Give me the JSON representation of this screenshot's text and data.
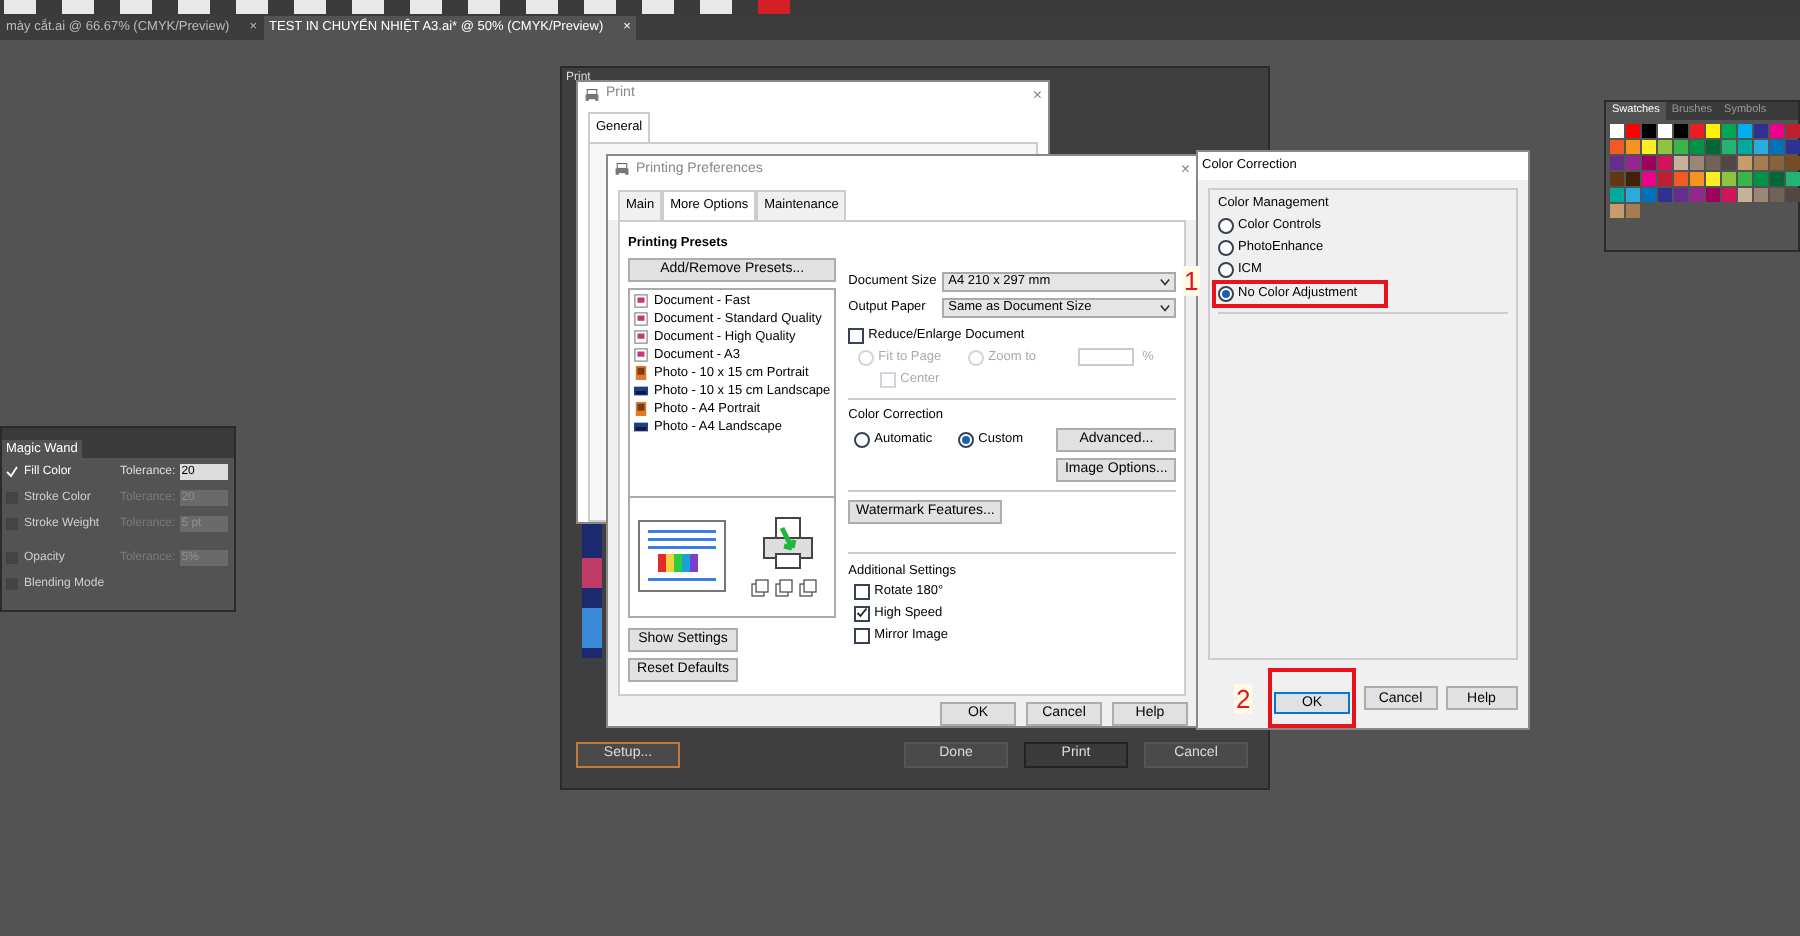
{
  "document_tabs": [
    {
      "label": "mày cắt.ai @ 66.67% (CMYK/Preview)",
      "close": "×",
      "selected": false
    },
    {
      "label": "TEST IN CHUYỂN NHIỆT A3.ai* @ 50% (CMYK/Preview)",
      "close": "×",
      "selected": true
    }
  ],
  "magic_wand": {
    "title": "Magic Wand",
    "options": [
      {
        "label": "Fill Color",
        "checked": true,
        "tolerance_label": "Tolerance:",
        "value": "20",
        "disabled": false
      },
      {
        "label": "Stroke Color",
        "checked": false,
        "tolerance_label": "Tolerance:",
        "value": "20",
        "disabled": true
      },
      {
        "label": "Stroke Weight",
        "checked": false,
        "tolerance_label": "Tolerance:",
        "value": "5 pt",
        "disabled": true
      },
      {
        "label": "Opacity",
        "checked": false,
        "tolerance_label": "Tolerance:",
        "value": "5%",
        "disabled": true
      },
      {
        "label": "Blending Mode",
        "checked": false
      }
    ]
  },
  "swatches": {
    "tabs": [
      {
        "label": "Swatches",
        "selected": true
      },
      {
        "label": "Brushes",
        "selected": false
      },
      {
        "label": "Symbols",
        "selected": false
      }
    ]
  },
  "illustrator_print": {
    "title": "Print",
    "buttons": [
      {
        "label": "Setup...",
        "kind": "outlined"
      },
      {
        "label": "Done",
        "kind": "plain"
      },
      {
        "label": "Print",
        "kind": "default"
      },
      {
        "label": "Cancel",
        "kind": "plain"
      }
    ]
  },
  "windows_print": {
    "title": "Print",
    "close": "×",
    "tabs": [
      {
        "label": "General",
        "selected": true
      }
    ]
  },
  "printing_preferences": {
    "title": "Printing Preferences",
    "close": "×",
    "tabs": [
      {
        "label": "Main",
        "selected": false
      },
      {
        "label": "More Options",
        "selected": true
      },
      {
        "label": "Maintenance",
        "selected": false
      }
    ],
    "presets_heading": "Printing Presets",
    "add_button": "Add/Remove Presets...",
    "presets": [
      {
        "label": "Document - Fast",
        "kind": "document"
      },
      {
        "label": "Document - Standard Quality",
        "kind": "document"
      },
      {
        "label": "Document - High Quality",
        "kind": "document"
      },
      {
        "label": "Document - A3",
        "kind": "document"
      },
      {
        "label": "Photo - 10 x 15 cm Portrait",
        "kind": "portrait"
      },
      {
        "label": "Photo - 10 x 15 cm Landscape",
        "kind": "landscape"
      },
      {
        "label": "Photo - A4 Portrait",
        "kind": "portrait"
      },
      {
        "label": "Photo - A4 Landscape",
        "kind": "landscape"
      }
    ],
    "show_settings": "Show Settings",
    "reset_defaults": "Reset Defaults",
    "document_size": {
      "label": "Document Size",
      "value": "A4 210 x 297 mm"
    },
    "output_paper": {
      "label": "Output Paper",
      "value": "Same as Document Size"
    },
    "reduce": {
      "label": "Reduce/Enlarge Document",
      "checked": false
    },
    "fit_to_page": {
      "label": "Fit to Page",
      "selected": false
    },
    "zoom_to": {
      "label": "Zoom to",
      "selected": false,
      "unit": "%"
    },
    "center": {
      "label": "Center",
      "checked": false
    },
    "color_correction": {
      "heading": "Color Correction",
      "options": [
        {
          "label": "Automatic",
          "selected": false
        },
        {
          "label": "Custom",
          "selected": true
        }
      ],
      "advanced": "Advanced...",
      "image_options": "Image Options..."
    },
    "watermark": "Watermark Features...",
    "additional": {
      "heading": "Additional Settings",
      "options": [
        {
          "label": "Rotate 180°",
          "checked": false
        },
        {
          "label": "High Speed",
          "checked": true
        },
        {
          "label": "Mirror Image",
          "checked": false
        }
      ]
    },
    "buttons": [
      "OK",
      "Cancel",
      "Help"
    ]
  },
  "color_correction_dialog": {
    "title": "Color Correction",
    "group": "Color Management",
    "options": [
      {
        "label": "Color Controls",
        "selected": false
      },
      {
        "label": "PhotoEnhance",
        "selected": false
      },
      {
        "label": "ICM",
        "selected": false
      },
      {
        "label": "No Color Adjustment",
        "selected": true
      }
    ],
    "buttons": [
      {
        "label": "OK",
        "default": true
      },
      {
        "label": "Cancel",
        "default": false
      },
      {
        "label": "Help",
        "default": false
      }
    ]
  },
  "annotations": [
    {
      "label": "1"
    },
    {
      "label": "2"
    }
  ]
}
